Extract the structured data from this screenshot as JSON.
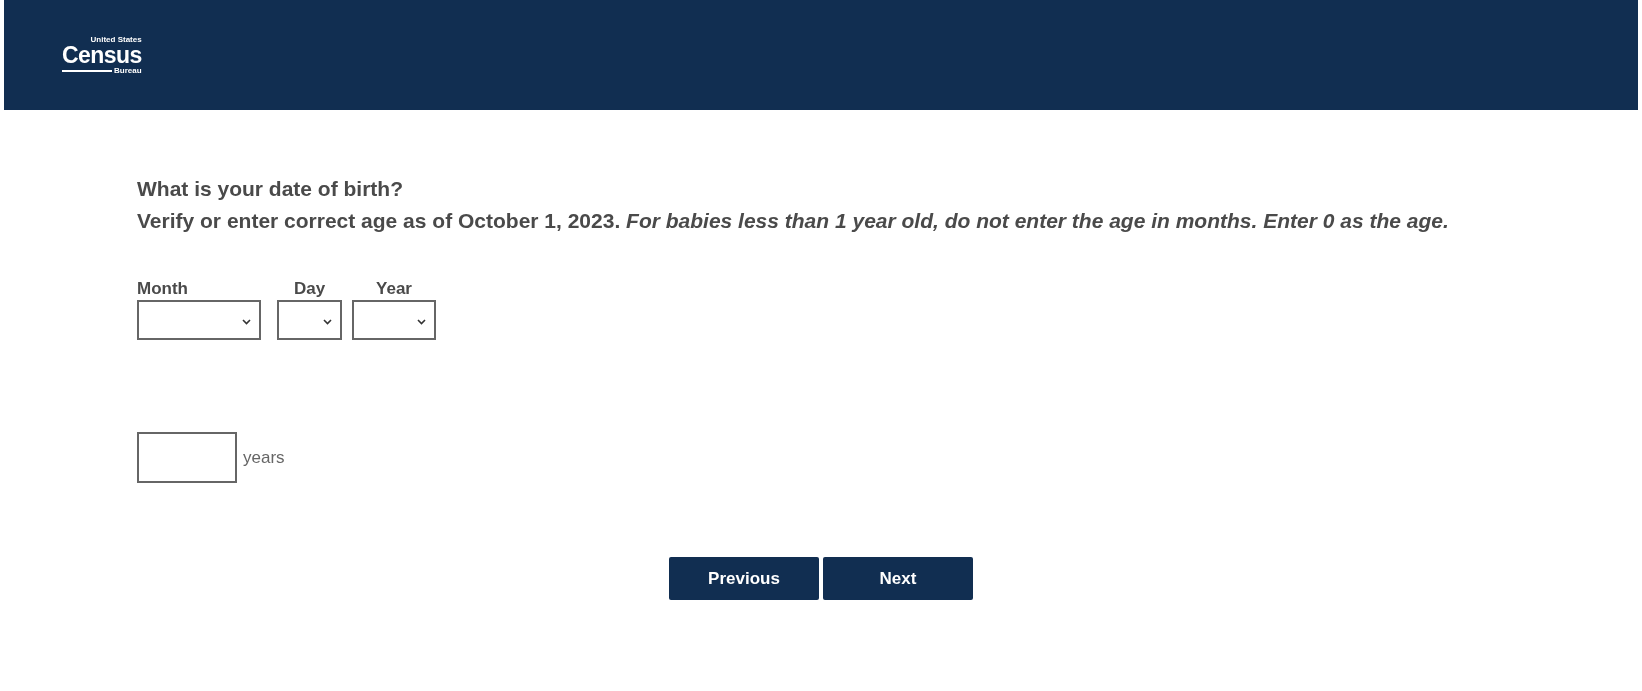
{
  "header": {
    "logo": {
      "top": "United States",
      "main": "Census",
      "bottom": "Bureau"
    }
  },
  "question": "What is your date of birth?",
  "instruction": "Verify or enter correct age as of October 1, 2023. *For babies less than 1 year old, do not enter the age in months. Enter 0 as the age.*",
  "date_fields": [
    {
      "label": "Month",
      "kind": "wide"
    },
    {
      "label": "Day",
      "kind": "narrow"
    },
    {
      "label": "Year",
      "kind": "medium"
    }
  ],
  "age_field": {
    "unit": "years"
  },
  "buttons": [
    "Previous",
    "Next"
  ]
}
